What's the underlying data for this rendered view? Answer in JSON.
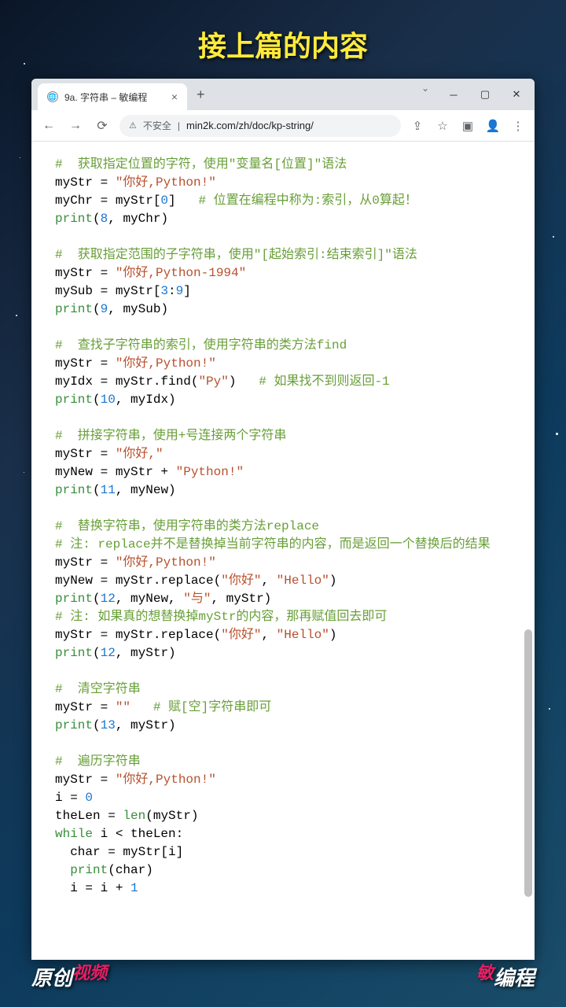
{
  "title": "接上篇的内容",
  "tab": {
    "label": "9a. 字符串 – 敏编程"
  },
  "url": {
    "warn": "不安全",
    "text": "min2k.com/zh/doc/kp-string/"
  },
  "badges": {
    "left_white": "原创",
    "left_pink": "视频",
    "right_pink": "敏",
    "right_white": "编程"
  },
  "code": {
    "c1": "#  获取指定位置的字符，使用\"变量名[位置]\"语法",
    "l1a": "myStr = ",
    "l1s": "\"你好,Python!\"",
    "l2a": "myChr = myStr[",
    "l2n": "0",
    "l2b": "]   ",
    "l2c": "# 位置在编程中称为:索引，从0算起！",
    "l3a": "print",
    "l3b": "(",
    "l3n": "8",
    "l3c": ", myChr)",
    "c2": "#  获取指定范围的子字符串，使用\"[起始索引:结束索引]\"语法",
    "l4a": "myStr = ",
    "l4s": "\"你好,Python-1994\"",
    "l5a": "mySub = myStr[",
    "l5n1": "3",
    "l5b": ":",
    "l5n2": "9",
    "l5c": "]",
    "l6a": "print",
    "l6b": "(",
    "l6n": "9",
    "l6c": ", mySub)",
    "c3": "#  查找子字符串的索引，使用字符串的类方法find",
    "l7a": "myStr = ",
    "l7s": "\"你好,Python!\"",
    "l8a": "myIdx = myStr.find(",
    "l8s": "\"Py\"",
    "l8b": ")   ",
    "l8c": "# 如果找不到则返回-1",
    "l9a": "print",
    "l9b": "(",
    "l9n": "10",
    "l9c": ", myIdx)",
    "c4": "#  拼接字符串，使用+号连接两个字符串",
    "l10a": "myStr = ",
    "l10s": "\"你好,\"",
    "l11a": "myNew = myStr + ",
    "l11s": "\"Python!\"",
    "l12a": "print",
    "l12b": "(",
    "l12n": "11",
    "l12c": ", myNew)",
    "c5": "#  替换字符串，使用字符串的类方法replace",
    "c6": "# 注: replace并不是替换掉当前字符串的内容，而是返回一个替换后的结果",
    "l13a": "myStr = ",
    "l13s": "\"你好,Python!\"",
    "l14a": "myNew = myStr.replace(",
    "l14s1": "\"你好\"",
    "l14b": ", ",
    "l14s2": "\"Hello\"",
    "l14c": ")",
    "l15a": "print",
    "l15b": "(",
    "l15n": "12",
    "l15c": ", myNew, ",
    "l15s": "\"与\"",
    "l15d": ", myStr)",
    "c7": "# 注: 如果真的想替换掉myStr的内容，那再赋值回去即可",
    "l16a": "myStr = myStr.replace(",
    "l16s1": "\"你好\"",
    "l16b": ", ",
    "l16s2": "\"Hello\"",
    "l16c": ")",
    "l17a": "print",
    "l17b": "(",
    "l17n": "12",
    "l17c": ", myStr)",
    "c8": "#  清空字符串",
    "l18a": "myStr = ",
    "l18s": "\"\"",
    "l18b": "   ",
    "l18c": "# 赋[空]字符串即可",
    "l19a": "print",
    "l19b": "(",
    "l19n": "13",
    "l19c": ", myStr)",
    "c9": "#  遍历字符串",
    "l20a": "myStr = ",
    "l20s": "\"你好,Python!\"",
    "l21a": "i = ",
    "l21n": "0",
    "l22a": "theLen = ",
    "l22k": "len",
    "l22b": "(myStr)",
    "l23k": "while",
    "l23a": " i < theLen:",
    "l24a": "  char = myStr[i]",
    "l25a": "  ",
    "l25k": "print",
    "l25b": "(char)",
    "l26a": "  i = i + ",
    "l26n": "1"
  }
}
